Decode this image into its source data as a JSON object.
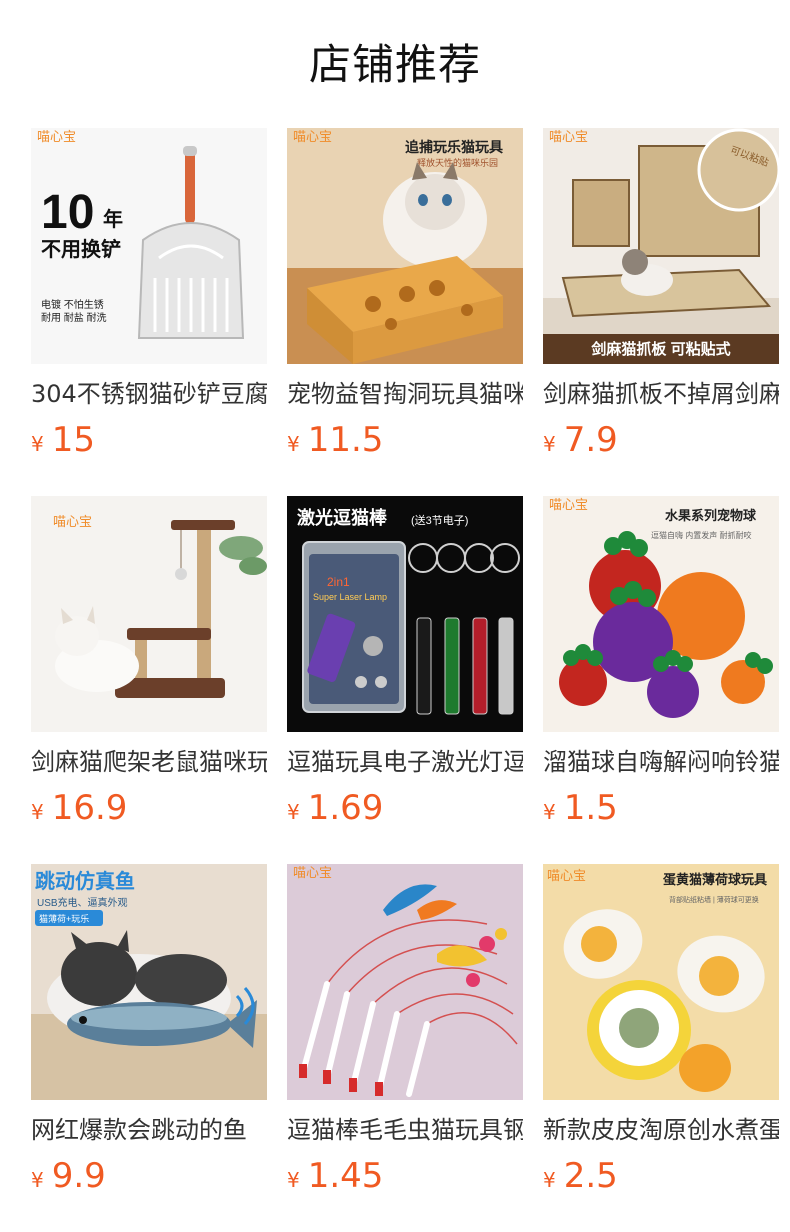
{
  "section_title": "店铺推荐",
  "currency_symbol": "¥",
  "brand_logo_text": "喵心宝",
  "products": [
    {
      "name": "304不锈钢猫砂铲豆腐",
      "price": "15",
      "image_texts": [
        "10",
        "年",
        "不用换铲",
        "电镀 不怕生锈",
        "耐用 耐盐 耐洗"
      ]
    },
    {
      "name": "宠物益智掏洞玩具猫咪",
      "price": "11.5",
      "image_texts": [
        "追捕玩乐猫玩具",
        "释放天性的猫咪乐园"
      ]
    },
    {
      "name": "剑麻猫抓板不掉屑剑麻",
      "price": "7.9",
      "image_texts": [
        "剑麻猫抓板 可粘贴式",
        "可以粘贴"
      ]
    },
    {
      "name": "剑麻猫爬架老鼠猫咪玩",
      "price": "16.9",
      "image_texts": []
    },
    {
      "name": "逗猫玩具电子激光灯逗",
      "price": "1.69",
      "image_texts": [
        "激光逗猫棒",
        "(送3节电子)",
        "2in1",
        "Super Laser Lamp"
      ]
    },
    {
      "name": "溜猫球自嗨解闷响铃猫",
      "price": "1.5",
      "image_texts": [
        "水果系列宠物球",
        "逗猫自嗨 内置发声 耐抓耐咬"
      ]
    },
    {
      "name": "网红爆款会跳动的鱼",
      "price": "9.9",
      "image_texts": [
        "跳动仿真鱼",
        "USB充电、逼真外观",
        "猫薄荷+玩乐"
      ]
    },
    {
      "name": "逗猫棒毛毛虫猫玩具钢",
      "price": "1.45",
      "image_texts": []
    },
    {
      "name": "新款皮皮淘原创水煮蛋",
      "price": "2.5",
      "image_texts": [
        "蛋黄猫薄荷球玩具",
        "背部贴纸粘墙 | 薄荷球可更换"
      ]
    }
  ],
  "colors": {
    "price": "#f05a22",
    "title": "#111111",
    "name": "#333333",
    "brand": "#f08c2a"
  }
}
